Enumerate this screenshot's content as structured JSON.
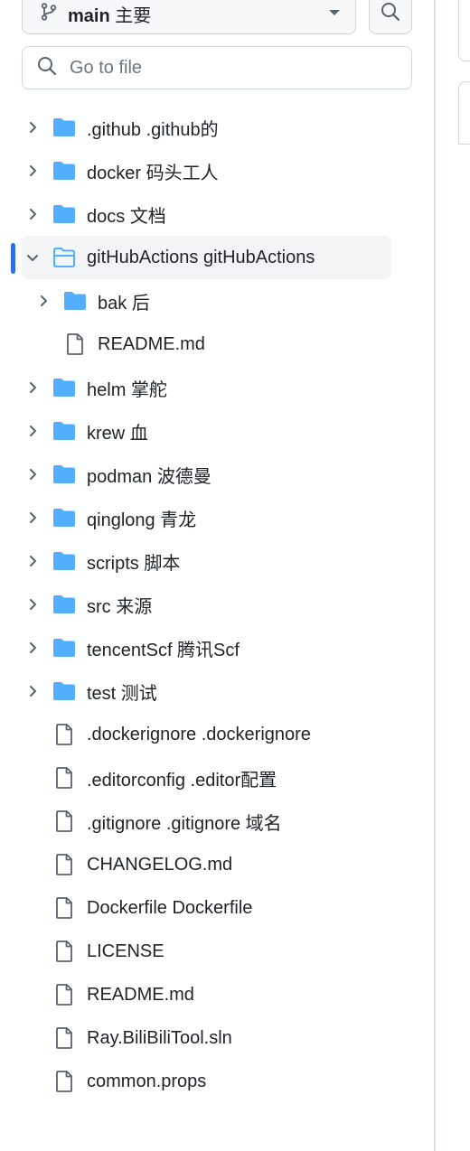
{
  "branch": {
    "name": "main",
    "name_translated": "主要"
  },
  "search": {
    "placeholder": "Go to file"
  },
  "tree": {
    "items": [
      {
        "label": ".github .github的",
        "kind": "folder",
        "expanded": false,
        "depth": 0
      },
      {
        "label": "docker 码头工人",
        "kind": "folder",
        "expanded": false,
        "depth": 0
      },
      {
        "label": "docs 文档",
        "kind": "folder",
        "expanded": false,
        "depth": 0
      },
      {
        "label": "gitHubActions gitHubActions",
        "kind": "folder",
        "expanded": true,
        "selected": true,
        "depth": 0
      },
      {
        "label": "bak 后",
        "kind": "folder",
        "expanded": false,
        "depth": 1
      },
      {
        "label": "README.md",
        "kind": "file",
        "depth": 1
      },
      {
        "label": "helm 掌舵",
        "kind": "folder",
        "expanded": false,
        "depth": 0
      },
      {
        "label": "krew 血",
        "kind": "folder",
        "expanded": false,
        "depth": 0
      },
      {
        "label": "podman 波德曼",
        "kind": "folder",
        "expanded": false,
        "depth": 0
      },
      {
        "label": "qinglong 青龙",
        "kind": "folder",
        "expanded": false,
        "depth": 0
      },
      {
        "label": "scripts 脚本",
        "kind": "folder",
        "expanded": false,
        "depth": 0
      },
      {
        "label": "src 来源",
        "kind": "folder",
        "expanded": false,
        "depth": 0
      },
      {
        "label": "tencentScf 腾讯Scf",
        "kind": "folder",
        "expanded": false,
        "depth": 0
      },
      {
        "label": "test 测试",
        "kind": "folder",
        "expanded": false,
        "depth": 0
      },
      {
        "label": ".dockerignore .dockerignore",
        "kind": "file",
        "depth": 0
      },
      {
        "label": ".editorconfig .editor配置",
        "kind": "file",
        "depth": 0
      },
      {
        "label": ".gitignore .gitignore 域名",
        "kind": "file",
        "depth": 0
      },
      {
        "label": "CHANGELOG.md",
        "kind": "file",
        "depth": 0
      },
      {
        "label": "Dockerfile Dockerfile",
        "kind": "file",
        "depth": 0
      },
      {
        "label": "LICENSE",
        "kind": "file",
        "depth": 0
      },
      {
        "label": "README.md",
        "kind": "file",
        "depth": 0
      },
      {
        "label": "Ray.BiliBiliTool.sln",
        "kind": "file",
        "depth": 0
      },
      {
        "label": "common.props",
        "kind": "file",
        "depth": 0
      }
    ]
  },
  "colors": {
    "folder": "#54aeff",
    "file_stroke": "#59636e",
    "active_bar": "#2f6fed"
  },
  "icons": {
    "branch": "git-branch-icon",
    "search": "search-icon",
    "dropdown": "triangle-down-icon",
    "folder": "folder-icon",
    "folder_open": "folder-open-icon",
    "file": "file-icon",
    "chevron_right": "chevron-right-icon",
    "chevron_down": "chevron-down-icon"
  }
}
